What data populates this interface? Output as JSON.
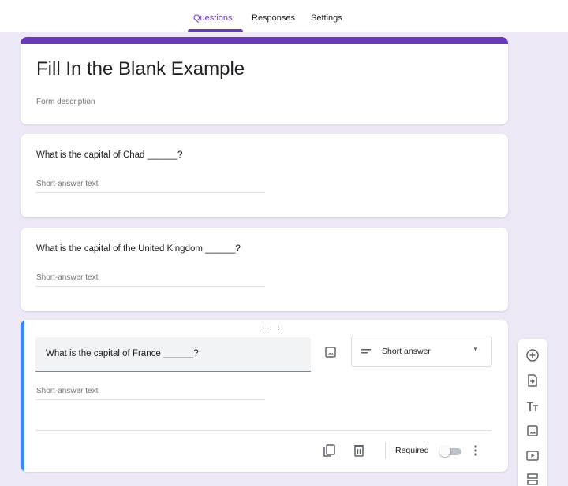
{
  "tabs": [
    {
      "label": "Questions",
      "active": true
    },
    {
      "label": "Responses",
      "active": false
    },
    {
      "label": "Settings",
      "active": false
    }
  ],
  "form": {
    "title": "Fill In the Blank Example",
    "description_placeholder": "Form description"
  },
  "questions": [
    {
      "title": "What is the capital of Chad ______?",
      "answer_placeholder": "Short-answer text"
    },
    {
      "title": "What is the capital of the United Kingdom ______?",
      "answer_placeholder": "Short-answer text"
    },
    {
      "title": "What is the capital of France ______?",
      "answer_placeholder": "Short-answer text",
      "type": "Short answer",
      "required_label": "Required",
      "required": false
    }
  ],
  "toolbar_icons": [
    "add-question-icon",
    "import-questions-icon",
    "add-title-icon",
    "add-image-icon",
    "add-video-icon",
    "add-section-icon"
  ],
  "colors": {
    "theme": "#673ab7",
    "background": "#ede8f6",
    "active_card_bar": "#4285f4"
  }
}
